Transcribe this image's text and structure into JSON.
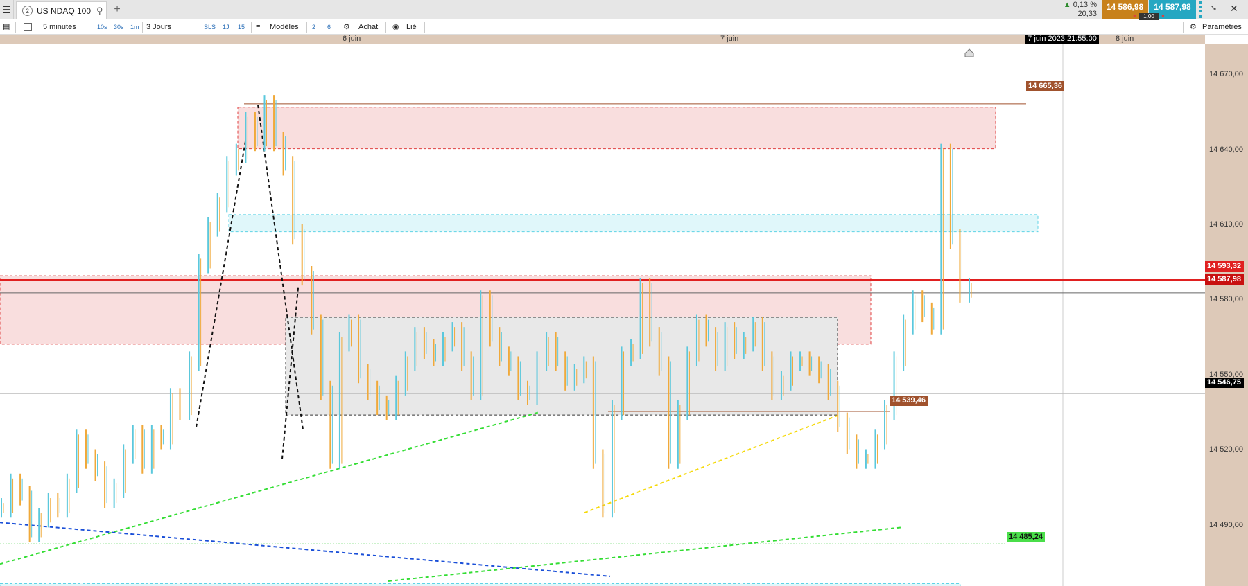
{
  "tab": {
    "number": "2",
    "title": "US NDAQ 100",
    "search_icon": "search-icon",
    "add_label": "+"
  },
  "quote": {
    "change_pct": "0,13 %",
    "change_abs": "20,33",
    "bid": "14 586,98",
    "ask": "14 587,98",
    "spread": "1,00",
    "colors": {
      "bid": "#c8811b",
      "ask": "#25a7c2",
      "up": "#2e8b2e"
    }
  },
  "window": {
    "minimize_label": "↘",
    "close_label": "✕"
  },
  "toolbar": {
    "timeframe": "5 minutes",
    "quick_10s": "10s",
    "quick_30s": "30s",
    "quick_1m": "1m",
    "period": "3 Jours",
    "sls": "SLS",
    "btn_1j": "1J",
    "btn_15": "15",
    "templates_label": "Modèles",
    "num_2": "2",
    "num_6": "6",
    "buy_label": "Achat",
    "linked_label": "Lié",
    "settings_label": "Paramètres"
  },
  "datebar": {
    "labels": [
      "6 juin",
      "7 juin",
      "8 juin"
    ],
    "cursor_date": "7 juin 2023 21:55:00"
  },
  "price_axis": {
    "ticks": [
      "14 670,00",
      "14 640,00",
      "14 610,00",
      "14 580,00",
      "14 550,00",
      "14 520,00",
      "14 490,00"
    ],
    "tags": {
      "level_high": "14 665,36",
      "level_red": "14 593,32",
      "current": "14 587,98",
      "crosshair": "14 546,75",
      "level_mid": "14 539,46",
      "level_low": "14 485,24"
    }
  },
  "chart_data": {
    "type": "candlestick",
    "symbol": "US NDAQ 100",
    "timeframe": "5 minutes",
    "period": "3 Jours",
    "x_labels": [
      "6 juin",
      "7 juin",
      "8 juin"
    ],
    "y_range": [
      14468,
      14690
    ],
    "y_ticks": [
      14670,
      14640,
      14610,
      14580,
      14550,
      14520,
      14490
    ],
    "horizontal_levels": [
      {
        "label": "14 665,36",
        "value": 14665.36,
        "color": "#a0522d"
      },
      {
        "label": "14 593,32",
        "value": 14593.32,
        "color": "#e02020"
      },
      {
        "label": "14 587,98",
        "value": 14587.98,
        "color": "#666666"
      },
      {
        "label": "14 546,75",
        "value": 14546.75,
        "color": "#bbbbbb"
      },
      {
        "label": "14 539,46",
        "value": 14539.46,
        "color": "#a0522d"
      },
      {
        "label": "14 485,24",
        "value": 14485.24,
        "color": "#33cc33"
      }
    ],
    "zones": [
      {
        "kind": "supply",
        "from": 14647,
        "to": 14664,
        "color": "#f9dede"
      },
      {
        "kind": "demand",
        "from": 14613,
        "to": 14620,
        "color": "#e0f7fa"
      },
      {
        "kind": "supply",
        "from": 14567,
        "to": 14595,
        "color": "#f9dede"
      },
      {
        "kind": "range",
        "from": 14538,
        "to": 14578,
        "color": "#e8e8e8"
      },
      {
        "kind": "demand",
        "from": 14462,
        "to": 14469,
        "color": "#e0f7fa"
      }
    ],
    "closes": [
      14500,
      14510,
      14505,
      14490,
      14496,
      14502,
      14500,
      14510,
      14528,
      14520,
      14515,
      14504,
      14508,
      14522,
      14530,
      14518,
      14530,
      14528,
      14545,
      14540,
      14560,
      14600,
      14615,
      14625,
      14640,
      14645,
      14658,
      14650,
      14665,
      14650,
      14640,
      14612,
      14595,
      14575,
      14548,
      14520,
      14568,
      14575,
      14555,
      14548,
      14542,
      14540,
      14550,
      14560,
      14570,
      14565,
      14562,
      14568,
      14572,
      14560,
      14548,
      14585,
      14570,
      14562,
      14558,
      14548,
      14546,
      14560,
      14568,
      14560,
      14552,
      14555,
      14558,
      14520,
      14500,
      14540,
      14562,
      14565,
      14590,
      14570,
      14558,
      14520,
      14540,
      14562,
      14575,
      14570,
      14560,
      14572,
      14565,
      14568,
      14574,
      14560,
      14548,
      14552,
      14560,
      14560,
      14558,
      14555,
      14548,
      14535,
      14526,
      14520,
      14520,
      14528,
      14540,
      14560,
      14575,
      14585,
      14580,
      14575,
      14645,
      14610,
      14588,
      14590
    ]
  }
}
